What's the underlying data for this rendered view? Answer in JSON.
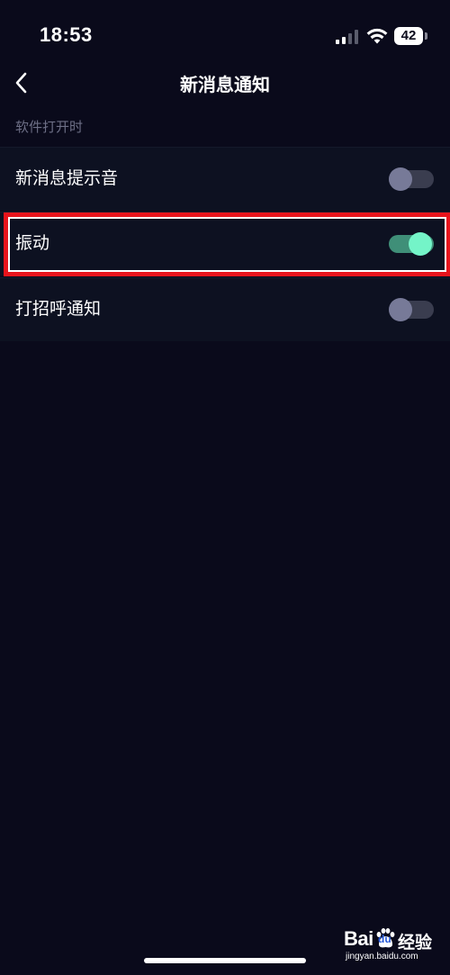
{
  "status_bar": {
    "time": "18:53",
    "battery": "42",
    "signal_icon": "cellular-signal-icon",
    "wifi_icon": "wifi-icon"
  },
  "nav": {
    "title": "新消息通知",
    "back_icon": "chevron-left-icon"
  },
  "section": {
    "header": "软件打开时"
  },
  "settings": [
    {
      "label": "新消息提示音",
      "enabled": false
    },
    {
      "label": "振动",
      "enabled": true
    },
    {
      "label": "打招呼通知",
      "enabled": false
    }
  ],
  "watermark": {
    "brand_left": "Bai",
    "brand_mid": "du",
    "brand_right": "经验",
    "domain": "jingyan.baidu.com"
  },
  "colors": {
    "background": "#0a0a1b",
    "row_background": "#0d1121",
    "toggle_on": "#74f4c8",
    "toggle_off": "#777a98",
    "highlight": "#e8141c"
  }
}
